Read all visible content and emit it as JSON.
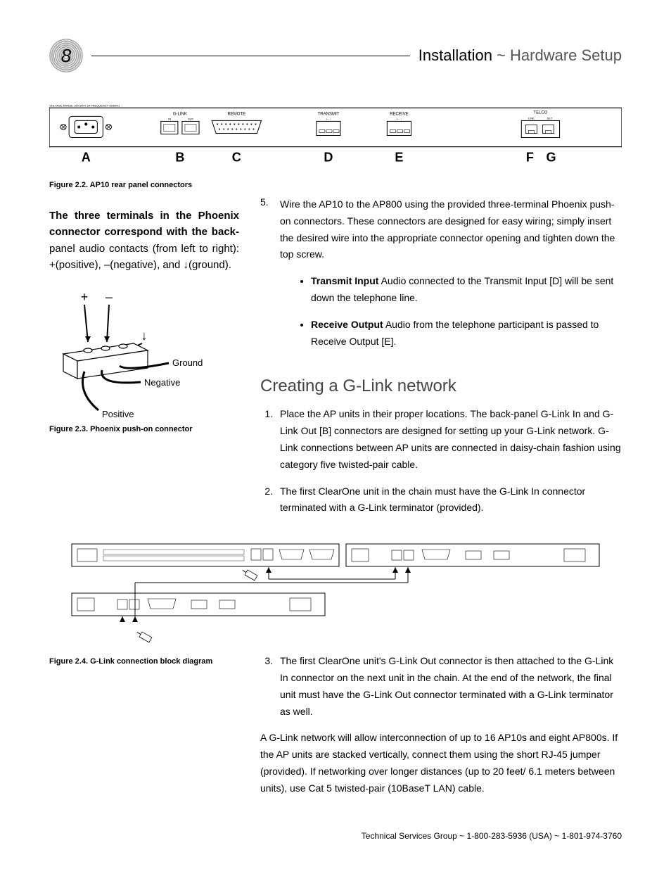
{
  "page_number": "8",
  "header": {
    "title_strong": "Installation",
    "title_sep": " ~ ",
    "title_light": "Hardware Setup"
  },
  "fig22": {
    "caption": "Figure 2.2. AP10 rear panel connectors",
    "labels": {
      "A": "A",
      "B": "B",
      "C": "C",
      "D": "D",
      "E": "E",
      "F": "F",
      "G": "G"
    },
    "panel_text": {
      "voltage": "VOLTAGE RANGE 100-240V 3A FREQUENCY 50/60Hz",
      "glink": "G-LINK",
      "in": "IN",
      "out": "OUT",
      "remote": "REMOTE",
      "transmit": "TRANSMIT",
      "receive": "RECEIVE",
      "telco": "TELCO",
      "line": "LINE",
      "set": "SET",
      "plusminus": "+  -  ↓"
    }
  },
  "note23": {
    "lead": "The three terminals in the Phoenix connector correspond with the back-",
    "rest": "panel audio contacts (from left to right): +(positive), –(negative), and ↓(ground)."
  },
  "fig23": {
    "caption": "Figure 2.3.  Phoenix push-on connector",
    "labels": {
      "plus": "+",
      "minus": "–",
      "arrow": "↓",
      "ground": "Ground",
      "negative": "Negative",
      "positive": "Positive"
    }
  },
  "step5": {
    "num": "5.",
    "text": "Wire the AP10 to the AP800 using the provided three-terminal Phoenix push-on connectors. These connectors are designed for easy wiring; simply insert the desired wire into the appropriate connector opening and tighten down the top screw.",
    "bullets": [
      {
        "bold": "Transmit Input",
        "text": "  Audio connected to the Transmit Input [D] will be sent down the telephone line."
      },
      {
        "bold": "Receive Output",
        "text": "  Audio from the telephone participant is passed to Receive Output [E]."
      }
    ]
  },
  "section_glink": {
    "heading": "Creating a G-Link network",
    "step1": "Place the AP units in their proper locations. The back-panel G-Link In and G-Link Out [B] connectors are designed for setting up your G-Link network. G-Link connections between AP units are connected in daisy-chain fashion using category five twisted-pair cable.",
    "step2": "The first ClearOne unit in the chain must have the G-Link In connector terminated with a G-Link terminator (provided).",
    "step3": "The first ClearOne unit's G-Link Out connector is then attached to the G-Link In connector on the next unit in the chain. At the end of the network, the final unit must have the G-Link Out connector terminated with a G-Link terminator as well.",
    "para": "A G-Link network will allow interconnection of up to 16 AP10s and eight AP800s. If the AP units are stacked vertically, connect them using the short RJ-45 jumper (provided). If networking over longer distances (up to 20 feet/ 6.1 meters between units), use Cat 5 twisted-pair (10BaseT LAN) cable."
  },
  "fig24": {
    "caption": "Figure 2.4. G-Link connection block diagram"
  },
  "footer": "Technical Services Group ~ 1-800-283-5936 (USA) ~ 1-801-974-3760"
}
